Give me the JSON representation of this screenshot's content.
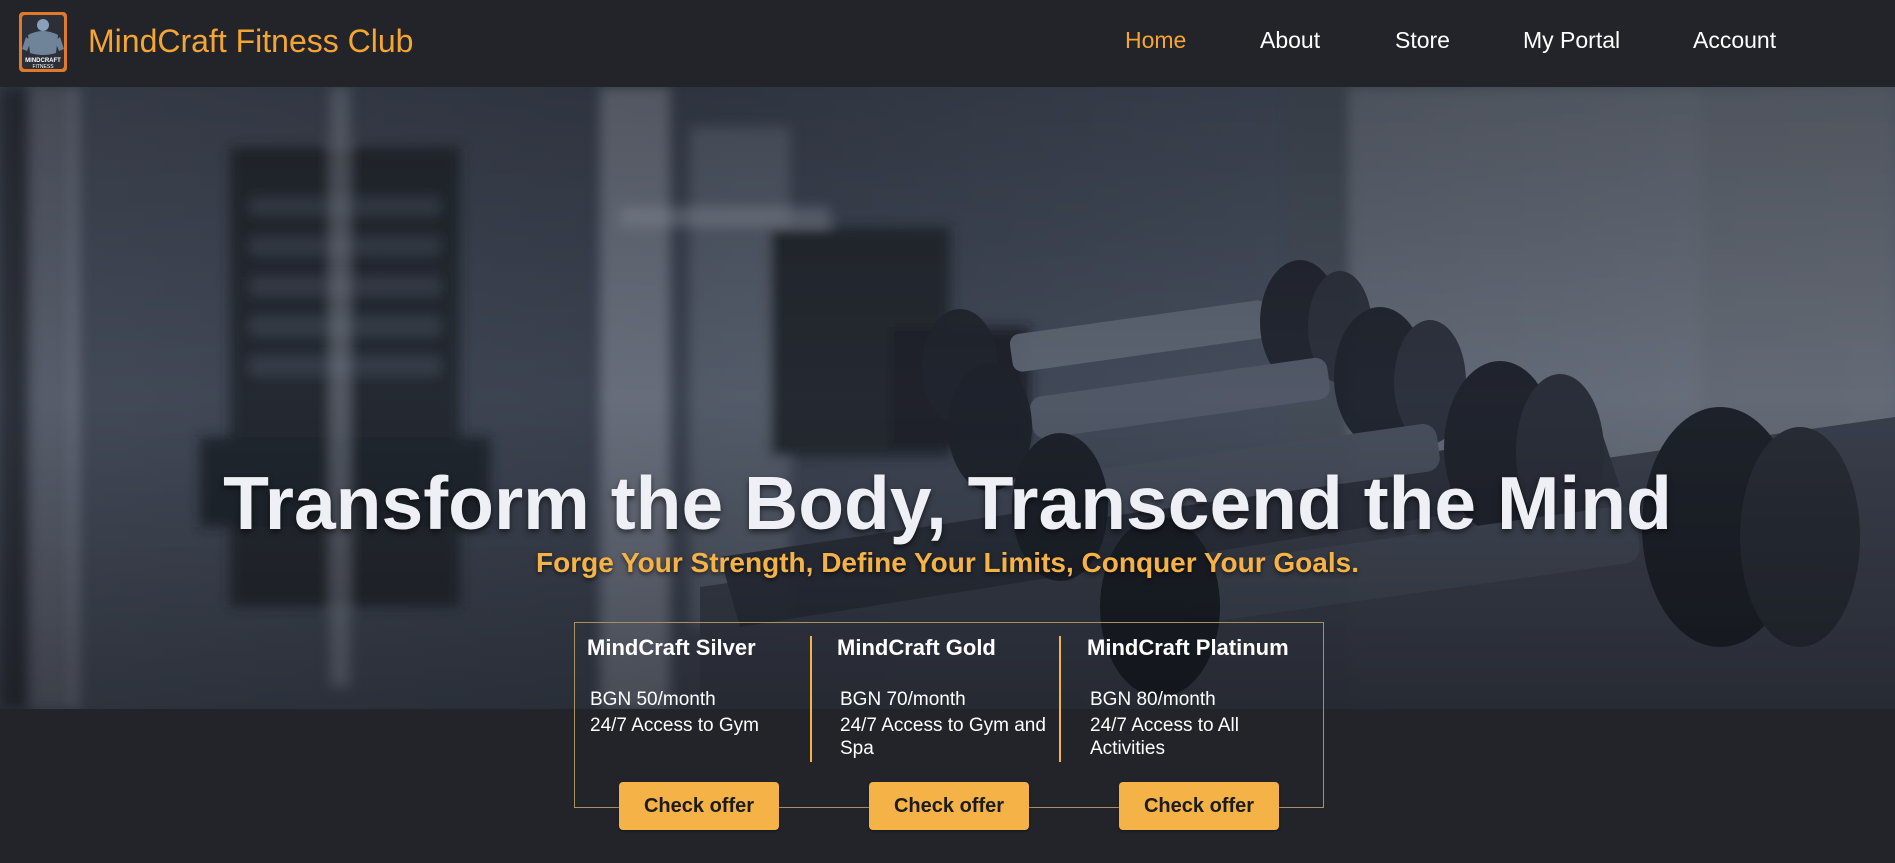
{
  "header": {
    "brand": "MindCraft Fitness Club",
    "logo_text_line1": "MINDCRAFT",
    "logo_text_line2": "FITNESS",
    "nav": [
      {
        "label": "Home",
        "active": true
      },
      {
        "label": "About",
        "active": false
      },
      {
        "label": "Store",
        "active": false
      },
      {
        "label": "My Portal",
        "active": false
      },
      {
        "label": "Account",
        "active": false
      }
    ]
  },
  "hero": {
    "title": "Transform the Body, Transcend the Mind",
    "subtitle": "Forge Your Strength, Define Your Limits, Conquer Your Goals."
  },
  "offers": [
    {
      "title": "MindCraft Silver",
      "price": "BGN 50/month",
      "description": "24/7 Access to Gym",
      "button": "Check offer"
    },
    {
      "title": "MindCraft Gold",
      "price": "BGN 70/month",
      "description": "24/7 Access to Gym and Spa",
      "button": "Check offer"
    },
    {
      "title": "MindCraft Platinum",
      "price": "BGN 80/month",
      "description": "24/7 Access to All Activities",
      "button": "Check offer"
    }
  ],
  "colors": {
    "accent": "#f5a532",
    "button": "#f5b246",
    "background": "#22242a"
  },
  "icons": {
    "logo": "muscular-man-logo-icon"
  }
}
